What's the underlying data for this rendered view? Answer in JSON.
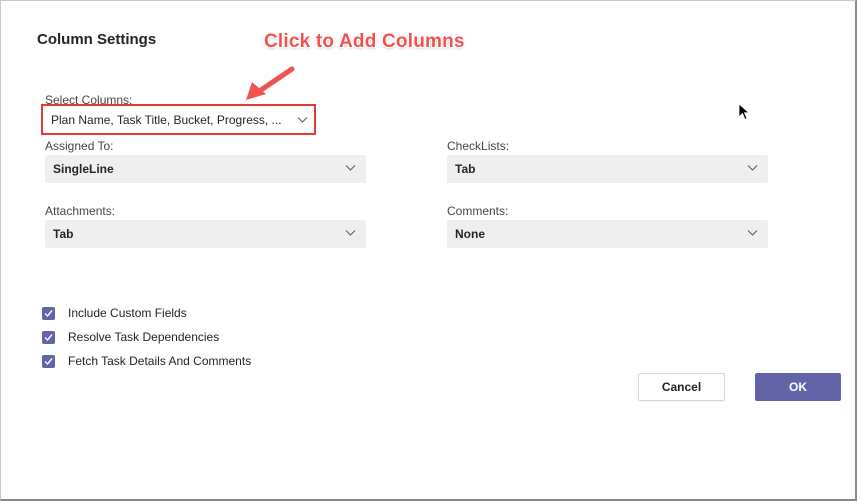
{
  "dialog": {
    "title": "Column Settings"
  },
  "annotation": {
    "text": "Click to Add Columns",
    "color": "#ef5350"
  },
  "select_columns": {
    "label": "Select Columns:",
    "value": "Plan Name, Task Title, Bucket, Progress, ..."
  },
  "assigned_to": {
    "label": "Assigned To:",
    "value": "SingleLine"
  },
  "checklists": {
    "label": "CheckLists:",
    "value": "Tab"
  },
  "attachments": {
    "label": "Attachments:",
    "value": "Tab"
  },
  "comments": {
    "label": "Comments:",
    "value": "None"
  },
  "options": [
    {
      "label": "Include Custom Fields",
      "checked": true
    },
    {
      "label": "Resolve Task Dependencies",
      "checked": true
    },
    {
      "label": "Fetch Task Details And Comments",
      "checked": true
    }
  ],
  "buttons": {
    "cancel": "Cancel",
    "ok": "OK"
  },
  "colors": {
    "accent": "#6264a7",
    "highlight_box": "#e53935",
    "select_bg": "#f0efef"
  }
}
